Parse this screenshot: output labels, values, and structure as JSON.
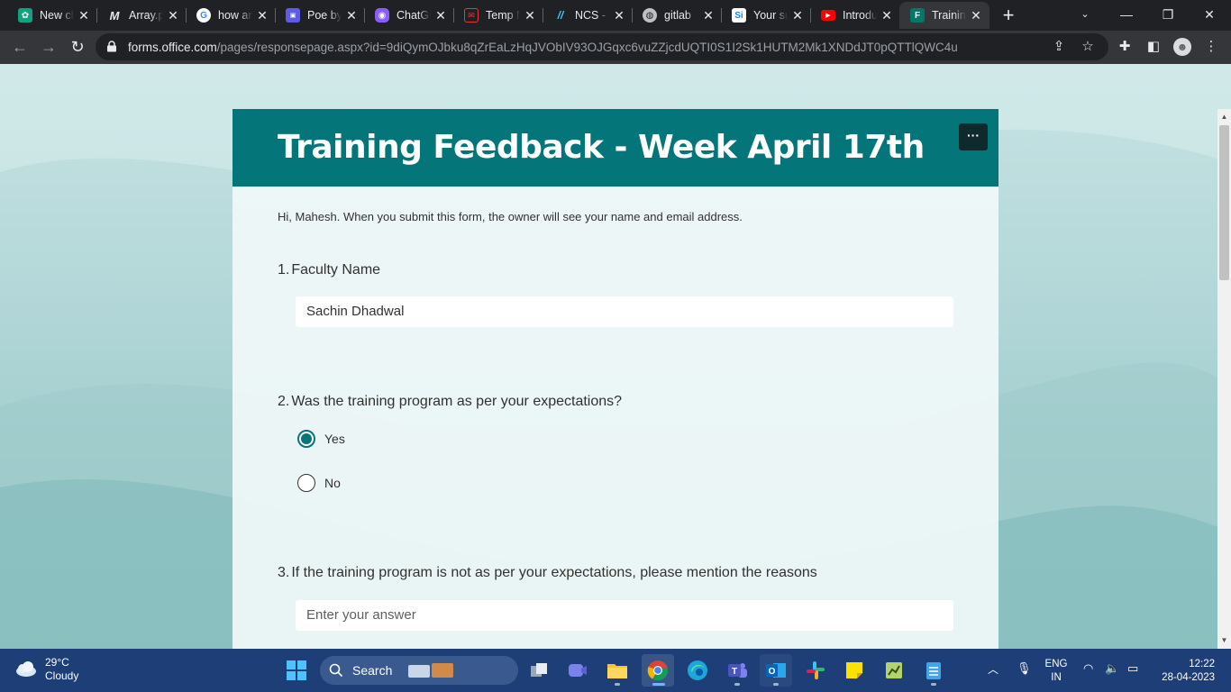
{
  "browser": {
    "tabs": [
      {
        "title": "New chat",
        "icon": "openai-icon",
        "color": "#10a37f"
      },
      {
        "title": "Array.prototype",
        "icon": "mdn-icon",
        "color": "#202124"
      },
      {
        "title": "how are",
        "icon": "google-icon",
        "color": "#ffffff"
      },
      {
        "title": "Poe by Quora",
        "icon": "poe-icon",
        "color": "#5e5ce6"
      },
      {
        "title": "ChatGPT",
        "icon": "chatgpt-icon",
        "color": "#8b5cf6"
      },
      {
        "title": "Temp Mail",
        "icon": "mail-icon",
        "color": "#e53935"
      },
      {
        "title": "NCS - ",
        "icon": "ncs-icon",
        "color": "#4fc3f7"
      },
      {
        "title": "gitlab",
        "icon": "globe-icon",
        "color": "#bdc1c6"
      },
      {
        "title": "Your sub",
        "icon": "si-icon",
        "color": "#1e88e5"
      },
      {
        "title": "Introduction",
        "icon": "youtube-icon",
        "color": "#ff0000"
      },
      {
        "title": "Training",
        "icon": "forms-icon",
        "color": "#077568",
        "active": true
      }
    ],
    "close_glyph": "✕",
    "new_tab_glyph": "+",
    "url_host": "forms.office.com",
    "url_path": "/pages/responsepage.aspx?id=9diQymOJbku8qZrEaLzHqJVObIV93OJGqxc6vuZZjcdUQTI0S1I2Sk1HUTM2Mk1XNDdJT0pQTTlQWC4u"
  },
  "form": {
    "title": "Training Feedback - Week April 17th",
    "more_glyph": "···",
    "intro": "Hi, Mahesh. When you submit this form, the owner will see your name and email address.",
    "questions": [
      {
        "number": "1.",
        "text": "Faculty Name",
        "answer": "Sachin Dhadwal"
      },
      {
        "number": "2.",
        "text": "Was the training program as per your expectations?",
        "options": [
          {
            "label": "Yes",
            "selected": true
          },
          {
            "label": "No",
            "selected": false
          }
        ]
      },
      {
        "number": "3.",
        "text": "If the training program is not as per your expectations, please mention the reasons",
        "placeholder": "Enter your answer"
      }
    ],
    "accent_color": "#04767a"
  },
  "taskbar": {
    "weather_temp": "29°C",
    "weather_desc": "Cloudy",
    "search_label": "Search",
    "lang_line1": "ENG",
    "lang_line2": "IN",
    "time": "12:22",
    "date": "28-04-2023"
  }
}
